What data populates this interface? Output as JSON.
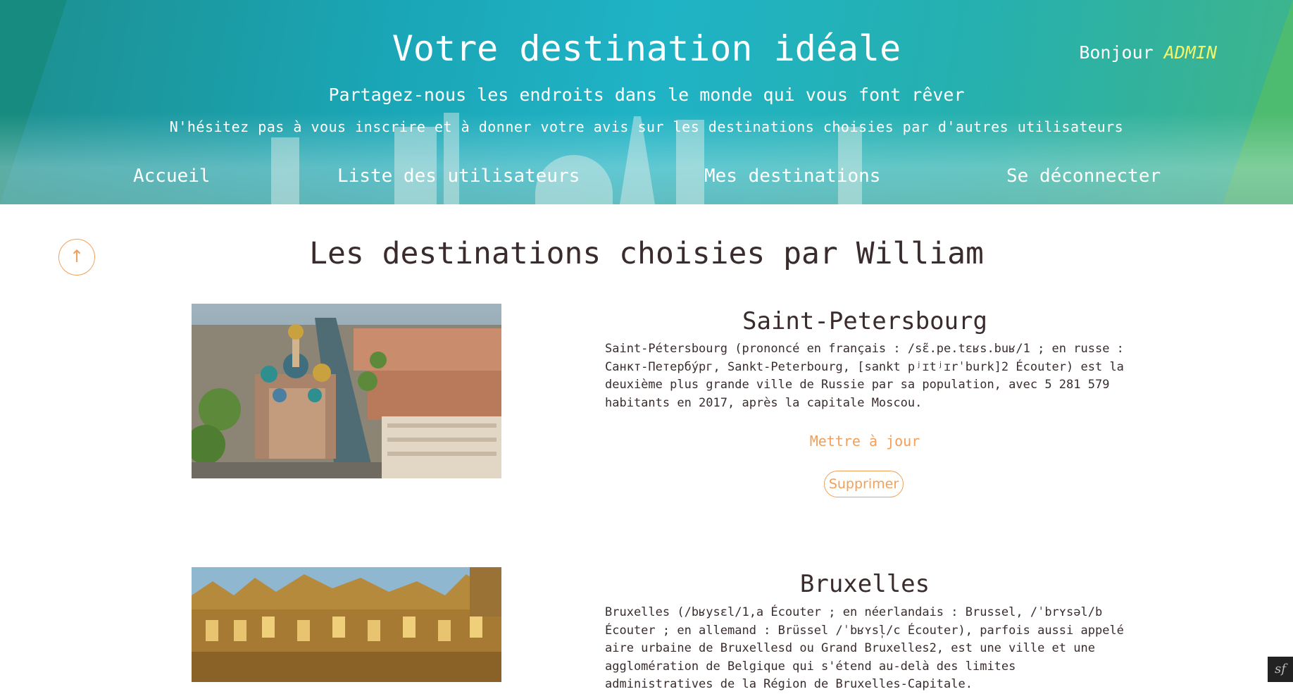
{
  "header": {
    "title": "Votre destination idéale",
    "subtitle": "Partagez-nous les endroits dans le monde qui vous font rêver",
    "tagline": "N'hésitez pas à vous inscrire et à donner votre avis sur les destinations choisies par d'autres utilisateurs",
    "greeting_prefix": "Bonjour",
    "username": "ADMIN"
  },
  "nav": {
    "items": [
      {
        "label": "Accueil"
      },
      {
        "label": "Liste des utilisateurs"
      },
      {
        "label": "Mes destinations"
      },
      {
        "label": "Se déconnecter"
      }
    ]
  },
  "main": {
    "page_title": "Les destinations choisies par William",
    "scroll_top_icon": "arrow-up-icon",
    "destinations": [
      {
        "name": "Saint-Petersbourg",
        "description": "Saint-Pétersbourg (prononcé en français : /sɛ̃.pe.tɛʁs.buʁ/1 ; en russe : Санкт-Петербу́рг, Sankt-Peterbourg, [sankt pʲɪtʲɪrˈburk]2 Écouter) est la deuxième plus grande ville de Russie par sa population, avec 5 281 579 habitants en 2017, après la capitale Moscou.",
        "update_label": "Mettre à jour",
        "delete_label": "Supprimer"
      },
      {
        "name": "Bruxelles",
        "description": "Bruxelles (/bʁysɛl/1,a Écouter ; en néerlandais : Brussel, /ˈbrʏsəl/b Écouter ; en allemand : Brüssel /ˈbʁʏsl̩/c Écouter), parfois aussi appelé aire urbaine de Bruxellesd ou Grand Bruxelles2, est une ville et une agglomération de Belgique qui s'étend au-delà des limites administratives de la Région de Bruxelles-Capitale."
      }
    ]
  },
  "colors": {
    "accent": "#f0a05a",
    "username": "#f4f46a",
    "text": "#3a2c2c"
  },
  "debug_toolbar": {
    "icon": "symfony-icon"
  }
}
